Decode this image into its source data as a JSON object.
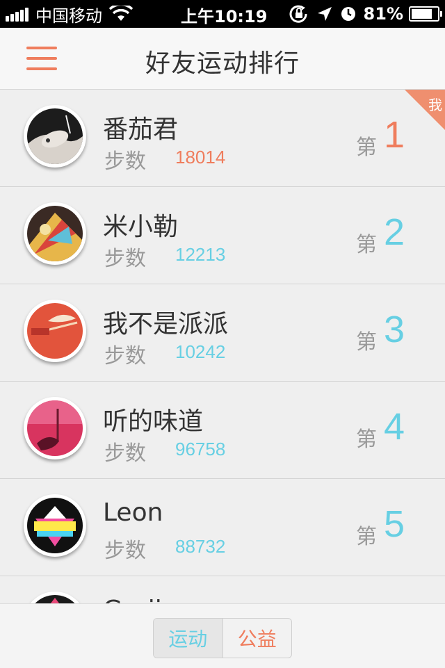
{
  "status_bar": {
    "carrier": "中国移动",
    "time": "上午10:19",
    "battery": "81%",
    "battery_level": 0.81,
    "icons": [
      "signal-icon",
      "wifi-icon",
      "rotation-lock-icon",
      "location-icon",
      "alarm-icon",
      "battery-icon"
    ]
  },
  "nav": {
    "menu_icon": "hamburger-menu-icon",
    "title": "好友运动排行"
  },
  "colors": {
    "accent_orange": "#ef7d5d",
    "accent_cyan": "#67cfe3",
    "text_dark": "#333333",
    "text_gray": "#999999"
  },
  "friends": [
    {
      "name": "番茄君",
      "steps_label": "步数",
      "steps": "18014",
      "rank_prefix": "第",
      "rank": "1",
      "is_me": true,
      "me_badge": "我"
    },
    {
      "name": "米小勒",
      "steps_label": "步数",
      "steps": "12213",
      "rank_prefix": "第",
      "rank": "2"
    },
    {
      "name": "我不是派派",
      "steps_label": "步数",
      "steps": "10242",
      "rank_prefix": "第",
      "rank": "3"
    },
    {
      "name": "听的味道",
      "steps_label": "步数",
      "steps": "96758",
      "rank_prefix": "第",
      "rank": "4"
    },
    {
      "name": "Leon",
      "steps_label": "步数",
      "steps": "88732",
      "rank_prefix": "第",
      "rank": "5"
    },
    {
      "name": "Gorjinar"
    }
  ],
  "bottom_tabs": {
    "sport": "运动",
    "charity": "公益"
  }
}
